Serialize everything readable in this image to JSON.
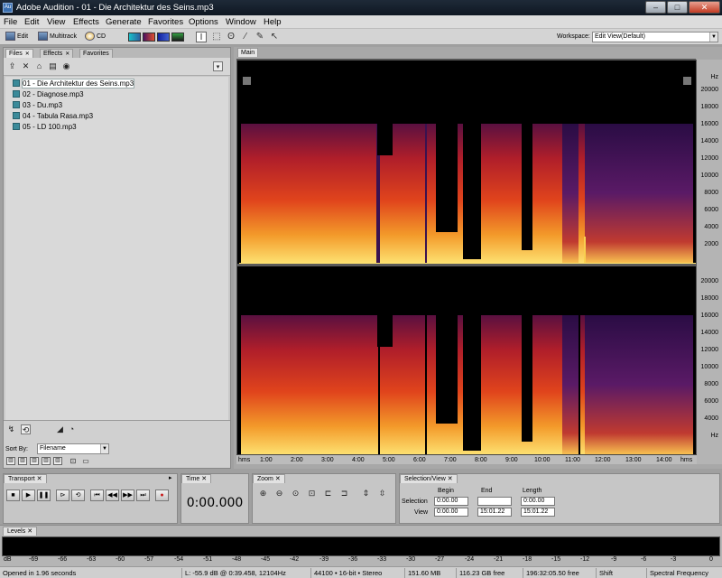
{
  "window": {
    "title": "Adobe Audition - 01 - Die Architektur des Seins.mp3",
    "app_icon": "Au"
  },
  "menu": [
    "File",
    "Edit",
    "View",
    "Effects",
    "Generate",
    "Favorites",
    "Options",
    "Window",
    "Help"
  ],
  "toolbar": {
    "edit": "Edit",
    "multitrack": "Multitrack",
    "cd": "CD",
    "workspace_label": "Workspace:",
    "workspace_value": "Edit View(Default)"
  },
  "left_panel": {
    "tabs": [
      "Files",
      "Effects",
      "Favorites"
    ],
    "files": [
      "01 - Die Architektur des Seins.mp3",
      "02 - Diagnose.mp3",
      "03 - Du.mp3",
      "04 - Tabula Rasa.mp3",
      "05 - LD 100.mp3"
    ],
    "sort_label": "Sort By:",
    "sort_value": "Filename"
  },
  "main": {
    "tab": "Main",
    "hz_unit": "Hz",
    "hz_ticks": [
      "20000",
      "18000",
      "16000",
      "14000",
      "12000",
      "10000",
      "8000",
      "6000",
      "4000",
      "2000"
    ],
    "time_unit": "hms",
    "time_ticks": [
      "1:00",
      "2:00",
      "3:00",
      "4:00",
      "5:00",
      "6:00",
      "7:00",
      "8:00",
      "9:00",
      "10:00",
      "11:00",
      "12:00",
      "13:00",
      "14:00"
    ]
  },
  "transport": {
    "tab": "Transport"
  },
  "time_panel": {
    "tab": "Time",
    "value": "0:00.000"
  },
  "zoom_panel": {
    "tab": "Zoom"
  },
  "selection": {
    "tab": "Selection/View",
    "headers": [
      "Begin",
      "End",
      "Length"
    ],
    "rows": [
      {
        "label": "Selection",
        "begin": "0:00.00",
        "end": "",
        "length": "0:00.00"
      },
      {
        "label": "View",
        "begin": "0:00.00",
        "end": "15:01.22",
        "length": "15:01.22"
      }
    ]
  },
  "levels": {
    "tab": "Levels",
    "scale": [
      "dB",
      "-69",
      "-66",
      "-63",
      "-60",
      "-57",
      "-54",
      "-51",
      "-48",
      "-45",
      "-42",
      "-39",
      "-36",
      "-33",
      "-30",
      "-27",
      "-24",
      "-21",
      "-18",
      "-15",
      "-12",
      "-9",
      "-6",
      "-3",
      "0"
    ]
  },
  "status": [
    "Opened in 1.96 seconds",
    "L: -55.9 dB @ 0:39.458, 12104Hz",
    "44100 • 16-bit • Stereo",
    "151.60 MB",
    "116.23 GB free",
    "196:32:05.50 free",
    "Shift",
    "Spectral Frequency"
  ],
  "colors": {
    "spectrogram_hot": "#f8d050",
    "spectrogram_mid": "#d0301a",
    "spectrogram_low": "#3a1250",
    "progress": "#57e0a6"
  }
}
